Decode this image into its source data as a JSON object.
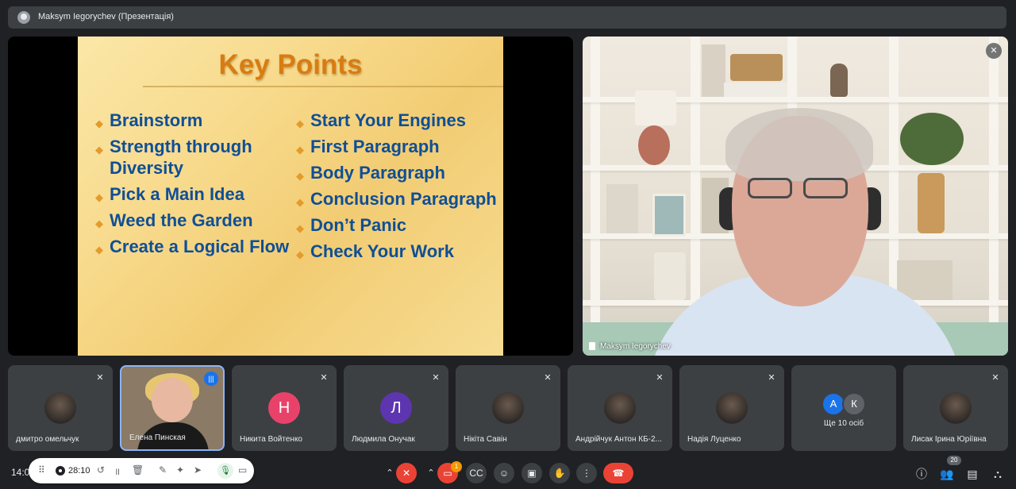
{
  "header": {
    "presenter_title": "Maksym Iegorychev (Презентація)"
  },
  "slide": {
    "title": "Key Points",
    "left_points": [
      "Brainstorm",
      "Strength through Diversity",
      "Pick a Main Idea",
      "Weed the Garden",
      "Create a Logical Flow"
    ],
    "right_points": [
      "Start Your Engines",
      "First Paragraph",
      "Body Paragraph",
      "Conclusion Paragraph",
      "Don’t Panic",
      "Check Your Work"
    ]
  },
  "speaker": {
    "name": "Maksym Iegorychev"
  },
  "participants": [
    {
      "name": "дмитро омельчук",
      "kind": "photo"
    },
    {
      "name": "Елена Пинская",
      "kind": "active"
    },
    {
      "name": "Никита Войтенко",
      "kind": "initial",
      "initial": "Н",
      "color": "#e8426b"
    },
    {
      "name": "Людмила Онучак",
      "kind": "initial",
      "initial": "Л",
      "color": "#5e35b1"
    },
    {
      "name": "Нікіта Савін",
      "kind": "photo"
    },
    {
      "name": "Андрійчук Антон КБ-2...",
      "kind": "photo"
    },
    {
      "name": "Надія Луценко",
      "kind": "photo"
    },
    {
      "name": "Ще 10 осіб",
      "kind": "more",
      "initials": [
        "А",
        "К"
      ],
      "colors": [
        "#1a73e8",
        "#5f6368"
      ]
    },
    {
      "name": "Лисак Ірина Юріївна",
      "kind": "photo"
    }
  ],
  "footer": {
    "clock": "14:0",
    "recording_time": "28:10",
    "people_count": "20",
    "chat_badge": "1"
  },
  "colors": {
    "end_call": "#ea4335",
    "accent": "#8ab4f8"
  }
}
